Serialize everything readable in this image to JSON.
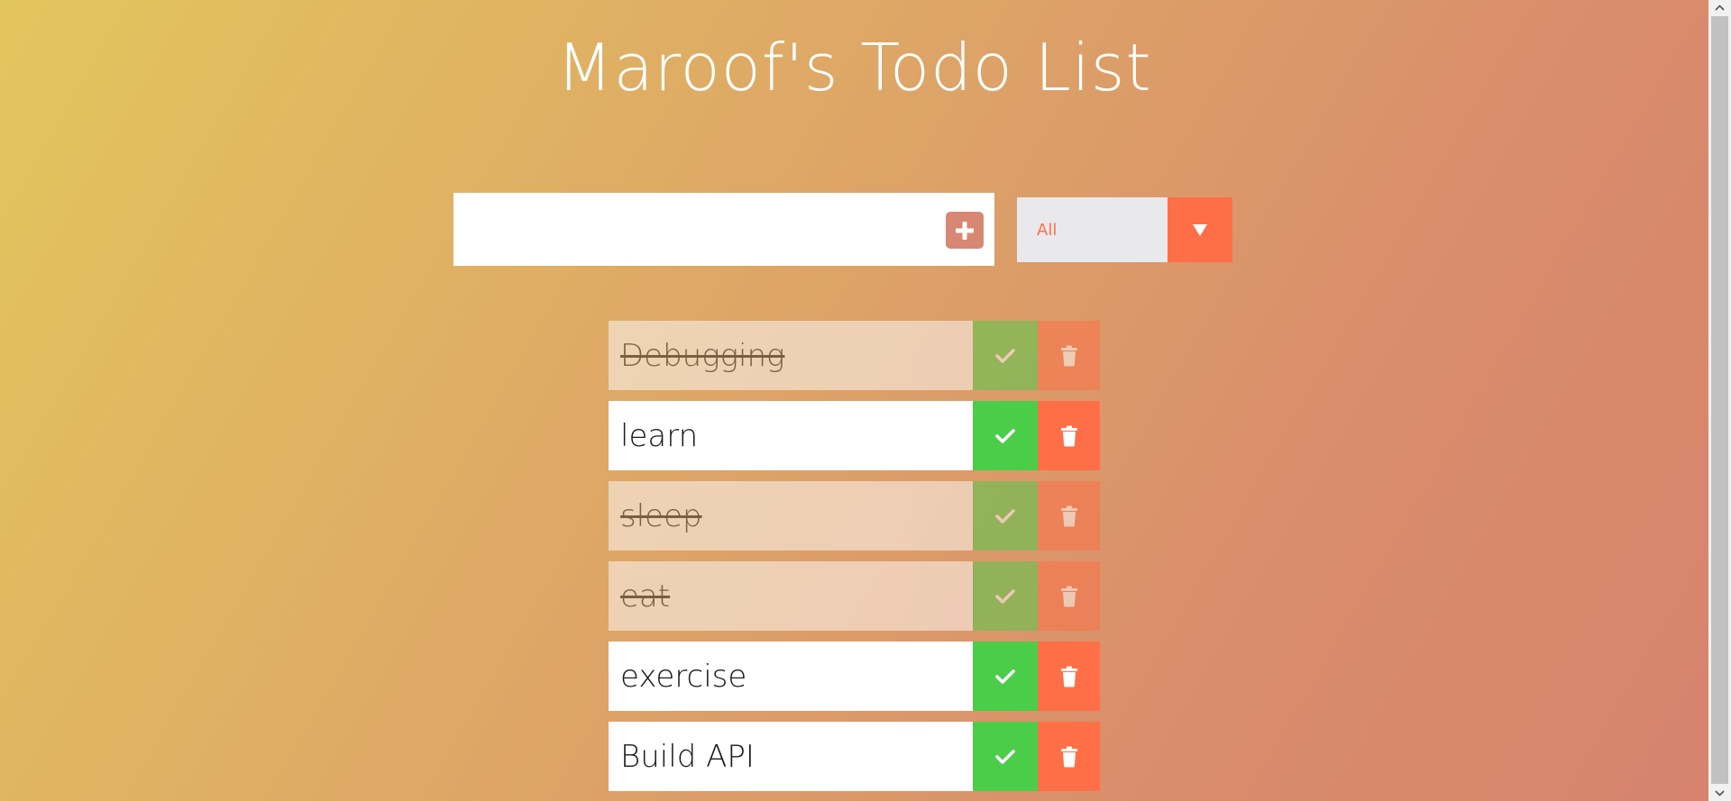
{
  "header": {
    "title": "Maroof's Todo List"
  },
  "form": {
    "input_value": "",
    "add_icon": "plus-icon",
    "filter": {
      "selected": "All",
      "arrow_icon": "caret-down-icon"
    }
  },
  "todos": [
    {
      "text": "Debugging",
      "completed": true
    },
    {
      "text": "learn",
      "completed": false
    },
    {
      "text": "sleep",
      "completed": true
    },
    {
      "text": "eat",
      "completed": true
    },
    {
      "text": "exercise",
      "completed": false
    },
    {
      "text": "Build API",
      "completed": false
    }
  ],
  "colors": {
    "check": "#4ccd4a",
    "trash": "#ff6f47",
    "add_button": "#d88773",
    "select_bg": "#e9e8ec"
  }
}
